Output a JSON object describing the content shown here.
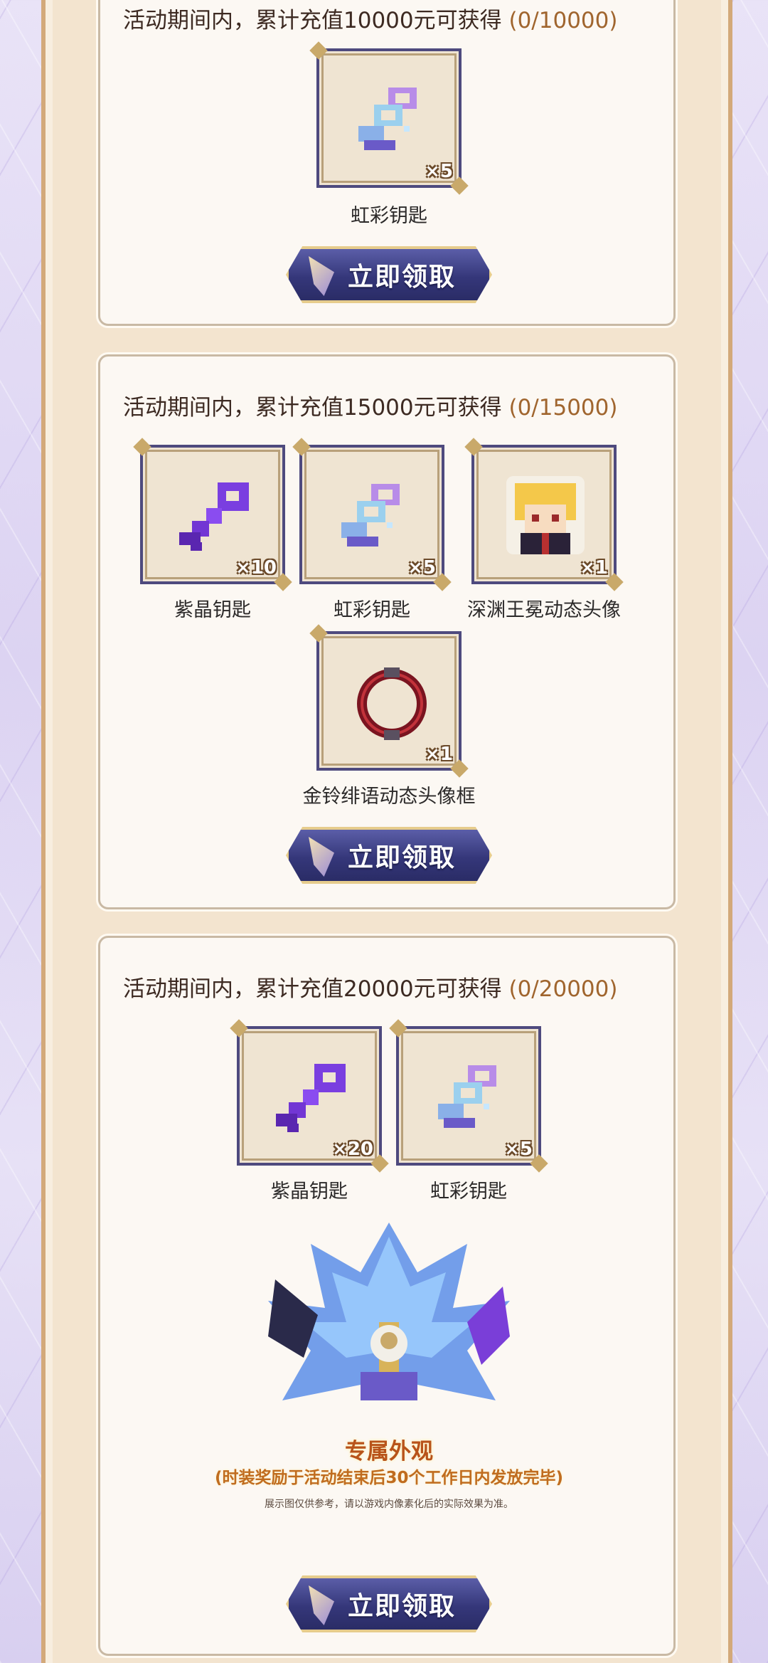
{
  "tiers": [
    {
      "requirement": "活动期间内，累计充值10000元可获得",
      "progress": "(0/10000)",
      "rewards": [
        {
          "name": "虹彩钥匙",
          "qty": "×5",
          "icon": "rainbow-key-icon"
        }
      ],
      "claim_label": "立即领取"
    },
    {
      "requirement": "活动期间内，累计充值15000元可获得",
      "progress": "(0/15000)",
      "rewards": [
        {
          "name": "紫晶钥匙",
          "qty": "×10",
          "icon": "amethyst-key-icon"
        },
        {
          "name": "虹彩钥匙",
          "qty": "×5",
          "icon": "rainbow-key-icon"
        },
        {
          "name": "深渊王冕动态头像",
          "qty": "×1",
          "icon": "avatar-icon"
        },
        {
          "name": "金铃绯语动态头像框",
          "qty": "×1",
          "icon": "avatar-frame-icon"
        }
      ],
      "claim_label": "立即领取"
    },
    {
      "requirement": "活动期间内，累计充值20000元可获得",
      "progress": "(0/20000)",
      "rewards": [
        {
          "name": "紫晶钥匙",
          "qty": "×20",
          "icon": "amethyst-key-icon"
        },
        {
          "name": "虹彩钥匙",
          "qty": "×5",
          "icon": "rainbow-key-icon"
        }
      ],
      "outfit": {
        "title": "专属外观",
        "note": "(时装奖励于活动结束后30个工作日内发放完毕)",
        "disclaimer": "展示图仅供参考，请以游戏内像素化后的实际效果为准。"
      },
      "claim_label": "立即领取"
    }
  ]
}
